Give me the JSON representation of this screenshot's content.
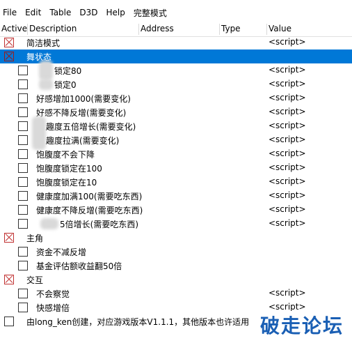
{
  "menu": [
    "File",
    "Edit",
    "Table",
    "D3D",
    "Help",
    "完整模式"
  ],
  "columns": {
    "active": "Active",
    "description": "Description",
    "address": "Address",
    "type": "Type",
    "value": "Value"
  },
  "colors": {
    "selection": "#0078d7",
    "group_x": "#c03030",
    "watermark": "#1a5fb4"
  },
  "rows": [
    {
      "desc": "简洁模式",
      "value": "<script>",
      "group": true
    },
    {
      "desc": "舞状态",
      "value": "",
      "group": true,
      "selected": true
    },
    {
      "desc": "锁定80",
      "value": "<script>"
    },
    {
      "desc": "锁定0",
      "value": "<script>"
    },
    {
      "desc": "好感增加1000(需要变化)",
      "value": "<script>"
    },
    {
      "desc": "好感不降反增(需要变化)",
      "value": "<script>"
    },
    {
      "desc": "趣度五倍增长(需要变化)",
      "value": "<script>"
    },
    {
      "desc": "趣度拉满(需要变化)",
      "value": "<script>"
    },
    {
      "desc": "饱腹度不会下降",
      "value": "<script>"
    },
    {
      "desc": "饱腹度锁定在100",
      "value": "<script>"
    },
    {
      "desc": "饱腹度锁定在10",
      "value": "<script>"
    },
    {
      "desc": "健康度加满100(需要吃东西)",
      "value": "<script>"
    },
    {
      "desc": "健康度不降反增(需要吃东西)",
      "value": "<script>"
    },
    {
      "desc": "5倍增长(需要吃东西)",
      "value": "<script>"
    },
    {
      "desc": "主角",
      "value": "",
      "group": true
    },
    {
      "desc": "资金不减反增",
      "value": ""
    },
    {
      "desc": "基金评估额收益翻50倍",
      "value": ""
    },
    {
      "desc": "交互",
      "value": "",
      "group": true
    },
    {
      "desc": "不会察觉",
      "value": "<script>"
    },
    {
      "desc": "快感增倍",
      "value": "<script>"
    },
    {
      "desc": "由long_ken创建，对应游戏版本V1.1.1，其他版本也许适用",
      "value": ""
    }
  ],
  "watermark": "破走论坛"
}
